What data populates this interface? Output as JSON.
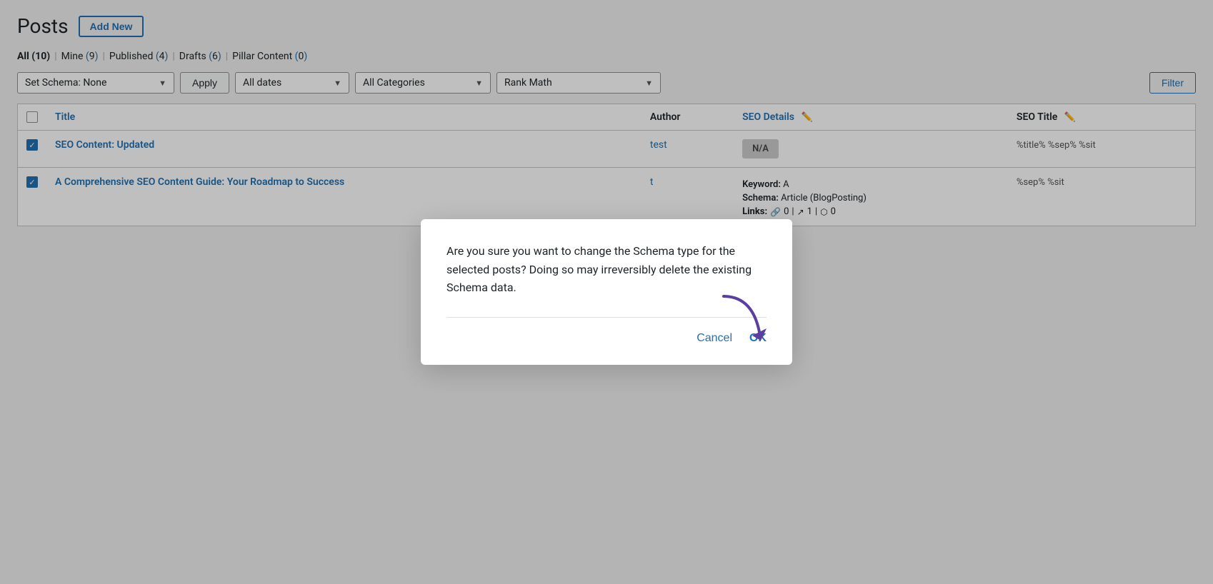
{
  "page": {
    "title": "Posts",
    "add_new_label": "Add New"
  },
  "filter_links": [
    {
      "label": "All",
      "count": "10",
      "active": true
    },
    {
      "label": "Mine",
      "count": "9",
      "active": false
    },
    {
      "label": "Published",
      "count": "4",
      "active": false
    },
    {
      "label": "Drafts",
      "count": "6",
      "active": false
    },
    {
      "label": "Pillar Content",
      "count": "0",
      "active": false
    }
  ],
  "filters": {
    "schema_label": "Set Schema: None",
    "apply_label": "Apply",
    "dates_label": "All dates",
    "categories_label": "All Categories",
    "rankmath_label": "Rank Math",
    "filter_label": "Filter"
  },
  "table": {
    "columns": {
      "checkbox": "",
      "title": "Title",
      "author": "Author",
      "seo_details": "SEO Details",
      "seo_title": "SEO Title"
    },
    "rows": [
      {
        "checked": true,
        "title": "SEO Content: Updated",
        "author": "test",
        "seo_badge": "N/A",
        "seo_title": "%title% %sep% %sit"
      },
      {
        "checked": true,
        "title": "A Comprehensive SEO Content Guide: Your Roadmap to Success",
        "author": "t",
        "seo_badge": "",
        "keyword_label": "Keyword:",
        "keyword_value": "A",
        "schema_label": "Schema:",
        "schema_value": "Article (BlogPosting)",
        "links_label": "Links:",
        "links_internal": "0",
        "links_external": "1",
        "links_other": "0",
        "seo_title": "%sep% %sit"
      }
    ]
  },
  "dialog": {
    "message": "Are you sure you want to change the Schema type for the selected posts? Doing so may irreversibly delete the existing Schema data.",
    "cancel_label": "Cancel",
    "ok_label": "OK"
  }
}
